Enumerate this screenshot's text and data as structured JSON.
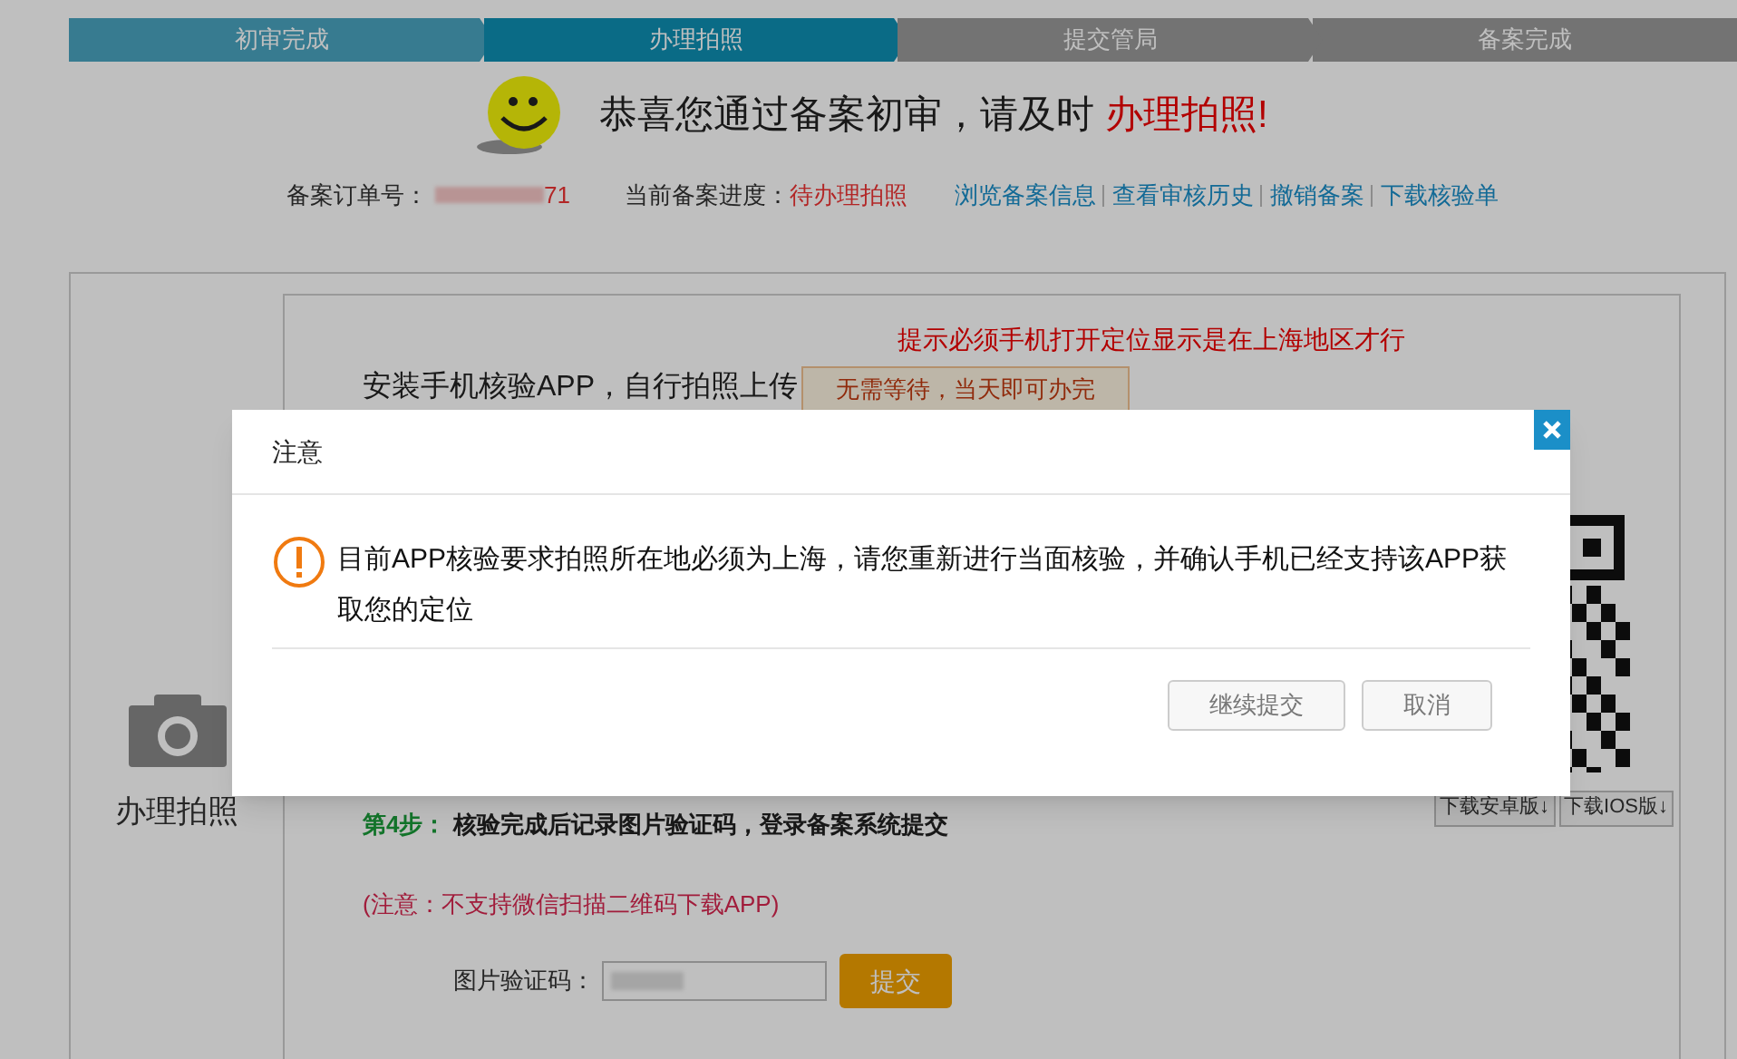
{
  "steps": [
    {
      "label": "初审完成",
      "done": true,
      "selected": false
    },
    {
      "label": "办理拍照",
      "done": false,
      "selected": true
    },
    {
      "label": "提交管局",
      "done": false,
      "selected": false
    },
    {
      "label": "备案完成",
      "done": false,
      "selected": false
    }
  ],
  "headline": {
    "text": "恭喜您通过备案初审，请及时",
    "highlight": "办理拍照!"
  },
  "order": {
    "label": "备案订单号：",
    "value": "71"
  },
  "progress": {
    "label": "当前备案进度：",
    "value": "待办理拍照"
  },
  "links": [
    "浏览备案信息",
    "查看审核历史",
    "撤销备案",
    "下载核验单"
  ],
  "sidebar": {
    "label": "办理拍照"
  },
  "panel": {
    "hint": "提示必须手机打开定位显示是在上海地区才行",
    "install_text": "安装手机核验APP，自行拍照上传",
    "tooltip": "无需等待，当天即可办完",
    "downloads": [
      "下载安卓版↓",
      "下载IOS版↓"
    ],
    "step4": {
      "label": "第4步：",
      "text": "核验完成后记录图片验证码，登录备案系统提交"
    },
    "notice": "(注意：不支持微信扫描二维码下载APP)",
    "captcha": {
      "label": "图片验证码：",
      "button": "提交"
    }
  },
  "dialog": {
    "title": "注意",
    "message": "目前APP核验要求拍照所在地必须为上海，请您重新进行当面核验，并确认手机已经支持该APP获取您的定位",
    "buttons": [
      "继续提交",
      "取消"
    ]
  }
}
